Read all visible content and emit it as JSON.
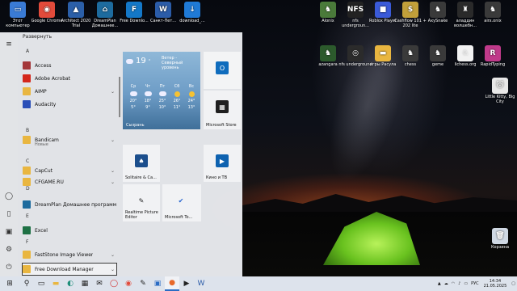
{
  "desktop": {
    "left_icons": [
      {
        "label": "Этот компьютер",
        "color": "#3a7bd5",
        "glyph": "▭"
      },
      {
        "label": "Google Chrome",
        "color": "#e24b3b",
        "glyph": "◉"
      },
      {
        "label": "Architect 2020 Trial",
        "color": "#2b5fa8",
        "glyph": "▲"
      },
      {
        "label": "DreamPlan Домашнее...",
        "color": "#1d6b9e",
        "glyph": "⌂"
      },
      {
        "label": "Free Downlo...",
        "color": "#1478c8",
        "glyph": "F"
      },
      {
        "label": "Санкт-Пет...",
        "color": "#2b5ca8",
        "glyph": "W"
      },
      {
        "label": "download_...",
        "color": "#1f7ad6",
        "glyph": "↓"
      }
    ],
    "right_icons_row1": [
      {
        "label": "Alonix",
        "color": "#4a7a3a",
        "glyph": "♞"
      },
      {
        "label": "nfs undergroun...",
        "color": "#222",
        "glyph": "NFS"
      },
      {
        "label": "Roblox Player",
        "color": "#3a5ad8",
        "glyph": "■"
      },
      {
        "label": "Cashflow 101 + 202 lite",
        "color": "#c2a03a",
        "glyph": "$"
      },
      {
        "label": "AxySnake",
        "color": "#3a3a3a",
        "glyph": "♞"
      },
      {
        "label": "аладдин волшебн...",
        "color": "#2a2a2a",
        "glyph": "♜"
      },
      {
        "label": "airx.onix",
        "color": "#3a3a3a",
        "glyph": "♞"
      }
    ],
    "right_icons_row2": [
      {
        "label": "azangara",
        "color": "#2c5a2c",
        "glyph": "♞"
      },
      {
        "label": "nfs underground",
        "color": "#2b2b2b",
        "glyph": "◎"
      },
      {
        "label": "игры Расула",
        "color": "#e9b640",
        "glyph": "▬"
      },
      {
        "label": "chess",
        "color": "#3a3a3a",
        "glyph": "♞"
      },
      {
        "label": "geme",
        "color": "#3a3a3a",
        "glyph": "♞"
      },
      {
        "label": "lichess.org",
        "color": "#f2f2f2",
        "glyph": "♘"
      },
      {
        "label": "RapidTyping",
        "color": "#c03a8a",
        "glyph": "R"
      }
    ],
    "right_icons_col": [
      {
        "label": "Little Kitty, Big City",
        "color": "#e8e8e8",
        "glyph": "🐱"
      },
      {
        "label": "Корзина",
        "color": "#cfd8e3",
        "glyph": "🗑"
      }
    ]
  },
  "start_menu": {
    "expand_label": "Развернуть",
    "letters": [
      "A",
      "B",
      "C",
      "D",
      "E",
      "F"
    ],
    "apps": [
      {
        "name": "Access",
        "color": "#a4373a",
        "folder": false,
        "chevron": false
      },
      {
        "name": "Adobe Acrobat",
        "color": "#d4271b",
        "folder": false,
        "chevron": false
      },
      {
        "name": "AIMP",
        "color": "#e9b640",
        "folder": true,
        "chevron": true
      },
      {
        "name": "Audacity",
        "color": "#2a4fb8",
        "folder": false,
        "chevron": false
      },
      {
        "name": "Bandicam",
        "color": "#e9b640",
        "folder": true,
        "chevron": true,
        "sub": "Новые"
      },
      {
        "name": "CapCut",
        "color": "#e9b640",
        "folder": true,
        "chevron": true
      },
      {
        "name": "CFGAME.RU",
        "color": "#e9b640",
        "folder": true,
        "chevron": true
      },
      {
        "name": "DreamPlan Домашнее программное обе...",
        "color": "#1d6b9e",
        "folder": false,
        "chevron": false
      },
      {
        "name": "Excel",
        "color": "#1e7145",
        "folder": false,
        "chevron": false
      },
      {
        "name": "FastStone Image Viewer",
        "color": "#e9b640",
        "folder": true,
        "chevron": true
      },
      {
        "name": "Free Download Manager",
        "color": "#e9b640",
        "folder": true,
        "chevron": true
      }
    ],
    "tiles": {
      "weather": {
        "temp": "19",
        "unit": "°",
        "desc1": "Ветер -",
        "desc2": "Северный",
        "desc3": "уровень",
        "days": [
          "Ср",
          "Чт",
          "Пт",
          "Сб",
          "Вс"
        ],
        "highs": [
          "20°",
          "18°",
          "25°",
          "26°",
          "24°"
        ],
        "lows": [
          "5°",
          "9°",
          "10°",
          "11°",
          "13°"
        ],
        "city": "Сызрань"
      },
      "outlook": {
        "label": "",
        "color": "#0f6cbd",
        "glyph": "O"
      },
      "store": {
        "label": "Microsoft Store",
        "color": "#1f1f1f",
        "glyph": "▦"
      },
      "solitaire": {
        "label": "Solitaire & Ca...",
        "color": "#1b4e8c",
        "glyph": "♠"
      },
      "movies": {
        "label": "Кино и ТВ",
        "color": "#0e62b0",
        "glyph": "▶"
      },
      "realtime": {
        "label": "Realtime Picture Editor",
        "color": "#2b2b2b",
        "glyph": "✎"
      },
      "todo": {
        "label": "Microsoft To...",
        "color": "#2564cf",
        "glyph": "✔"
      }
    }
  },
  "taskbar": {
    "lang": "РУС",
    "time": "14:34",
    "date": "21.05.2025"
  }
}
